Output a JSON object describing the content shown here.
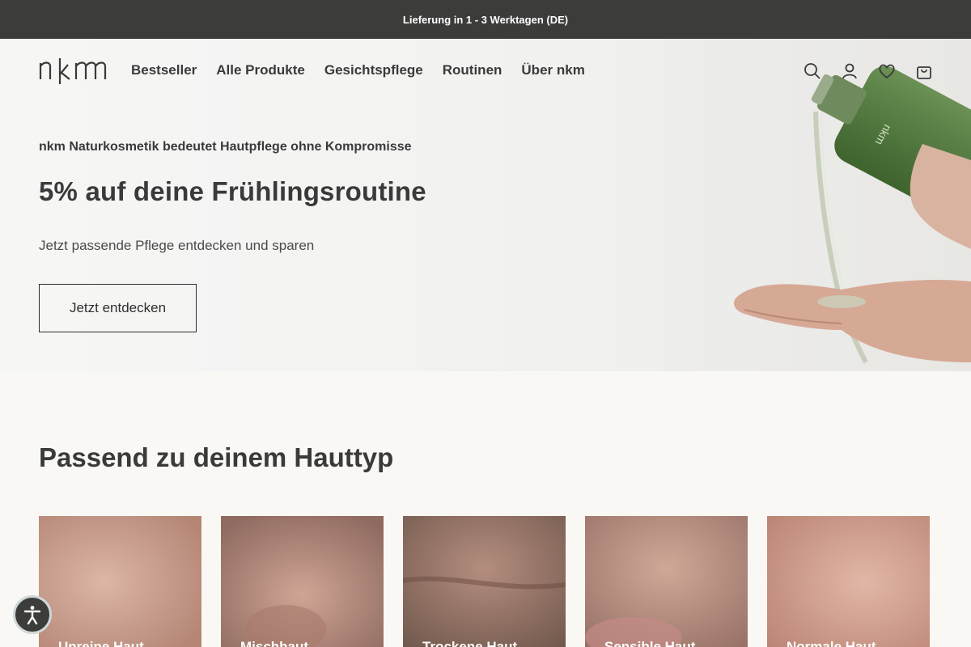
{
  "announcement": {
    "text": "Lieferung in 1 - 3 Werktagen (DE)"
  },
  "header": {
    "logo_text": "nkm",
    "nav": [
      {
        "label": "Bestseller"
      },
      {
        "label": "Alle Produkte"
      },
      {
        "label": "Gesichtspflege"
      },
      {
        "label": "Routinen"
      },
      {
        "label": "Über nkm"
      }
    ],
    "icons": [
      "search-icon",
      "account-icon",
      "heart-icon",
      "cart-icon"
    ]
  },
  "hero": {
    "eyebrow": "nkm Naturkosmetik bedeutet Hautpflege ohne Kompromisse",
    "title": "5% auf deine Frühlingsroutine",
    "subtitle": "Jetzt passende Pflege entdecken und sparen",
    "cta_label": "Jetzt entdecken",
    "bottle_label": "nkm"
  },
  "skin_types": {
    "title": "Passend zu deinem Hauttyp",
    "cards": [
      {
        "label": "Unreine Haut",
        "color": "#c9a293"
      },
      {
        "label": "Mischhaut",
        "color": "#b88f84"
      },
      {
        "label": "Trockene Haut",
        "color": "#9a7b6e"
      },
      {
        "label": "Sensible Haut",
        "color": "#b89385"
      },
      {
        "label": "Normale Haut",
        "color": "#d3a597"
      }
    ]
  },
  "accessibility": {
    "icon": "accessibility-icon"
  },
  "colors": {
    "announcement_bg": "#3c3c3b",
    "text": "#3a3a3a",
    "page_bg": "#faf8f4"
  }
}
